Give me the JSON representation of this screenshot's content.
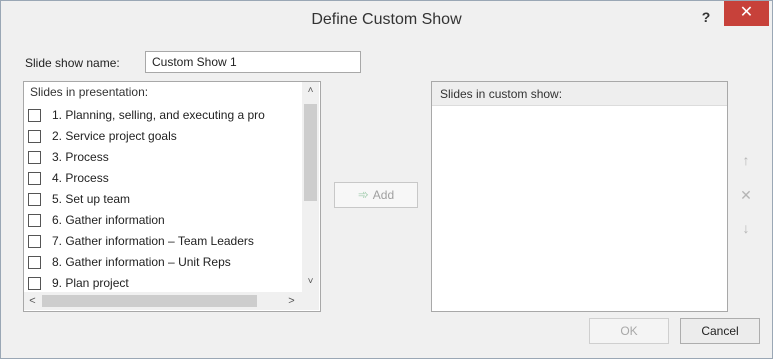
{
  "window": {
    "title": "Define Custom Show",
    "help_label": "?",
    "close_label": "✕"
  },
  "name_field": {
    "label": "Slide show name:",
    "value": "Custom Show 1"
  },
  "slides_panel": {
    "header": "Slides in presentation:",
    "items": [
      {
        "label": "1. Planning, selling, and executing  a pro",
        "checked": false
      },
      {
        "label": "2. Service project goals",
        "checked": false
      },
      {
        "label": "3. Process",
        "checked": false
      },
      {
        "label": "4. Process",
        "checked": false
      },
      {
        "label": "5. Set up team",
        "checked": false
      },
      {
        "label": "6. Gather information",
        "checked": false
      },
      {
        "label": "7. Gather information – Team Leaders",
        "checked": false
      },
      {
        "label": "8. Gather information – Unit Reps",
        "checked": false
      },
      {
        "label": "9. Plan project",
        "checked": false
      }
    ],
    "scroll_up_icon": "˄",
    "scroll_down_icon": "˅",
    "scroll_left_icon": "<",
    "scroll_right_icon": ">"
  },
  "add_button": {
    "label": "Add",
    "icon": "➾"
  },
  "custom_show_panel": {
    "header": "Slides in custom show:"
  },
  "side_buttons": {
    "move_up_icon": "↑",
    "remove_icon": "✕",
    "move_down_icon": "↓"
  },
  "footer": {
    "ok_label": "OK",
    "cancel_label": "Cancel"
  }
}
